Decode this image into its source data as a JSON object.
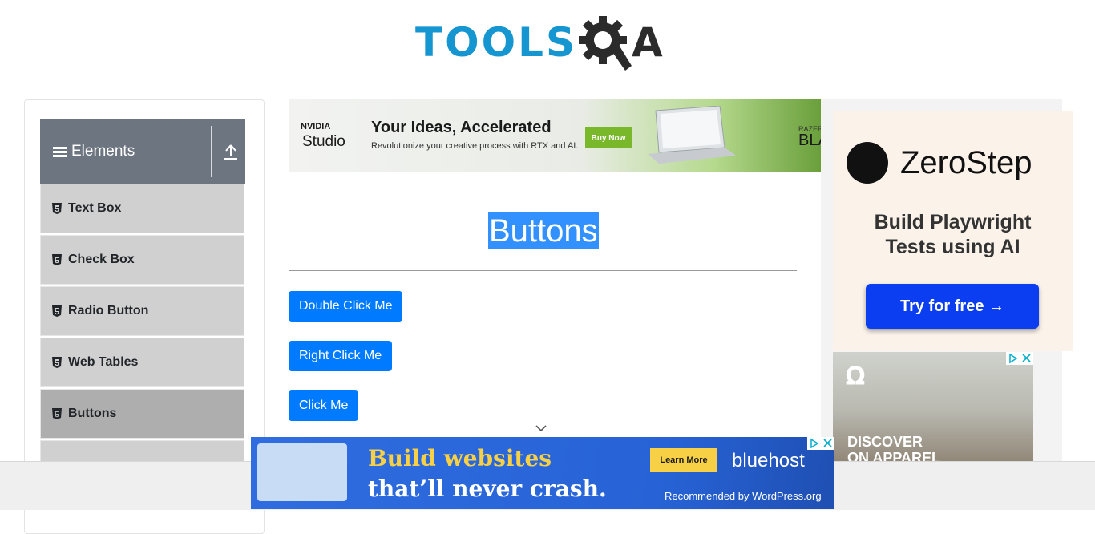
{
  "header": {
    "logo_text_left": "TOOLS",
    "logo_text_right": "QA"
  },
  "sidebar": {
    "group_title": "Elements",
    "items": [
      {
        "label": "Text Box"
      },
      {
        "label": "Check Box"
      },
      {
        "label": "Radio Button"
      },
      {
        "label": "Web Tables"
      },
      {
        "label": "Buttons",
        "active": true
      }
    ]
  },
  "top_banner": {
    "brand_small": "NVIDIA",
    "brand_large": "Studio",
    "headline": "Your Ideas, Accelerated",
    "subline": "Revolutionize your creative process with RTX and AI.",
    "cta": "Buy Now",
    "partner_small": "RAZER",
    "partner_large": "BLA"
  },
  "main": {
    "title": "Buttons",
    "buttons": {
      "double_click": "Double Click Me",
      "right_click": "Right Click Me",
      "click": "Click Me"
    }
  },
  "right_ad": {
    "brand": "ZeroStep",
    "line1": "Build Playwright",
    "line2": "Tests using AI",
    "cta": "Try for free →"
  },
  "on_ad": {
    "line1": "DISCOVER",
    "line2": "ON APPAREL"
  },
  "bottom_ad": {
    "line1": "Build websites",
    "line2": "that’ll never crash.",
    "cta": "Learn More",
    "brand": "bluehost",
    "recommended": "Recommended by WordPress.org"
  },
  "colors": {
    "accent": "#007bff",
    "logo_blue": "#1596d1",
    "sidebar_header": "#6d7580",
    "menu_item": "#d0d0d0",
    "menu_item_active": "#aeaeae",
    "selection": "#3390ff"
  },
  "icons": [
    "menu-icon",
    "upload-icon",
    "html5-icon",
    "chevron-down-icon",
    "gear-icon",
    "adchoices-icon",
    "close-icon"
  ]
}
